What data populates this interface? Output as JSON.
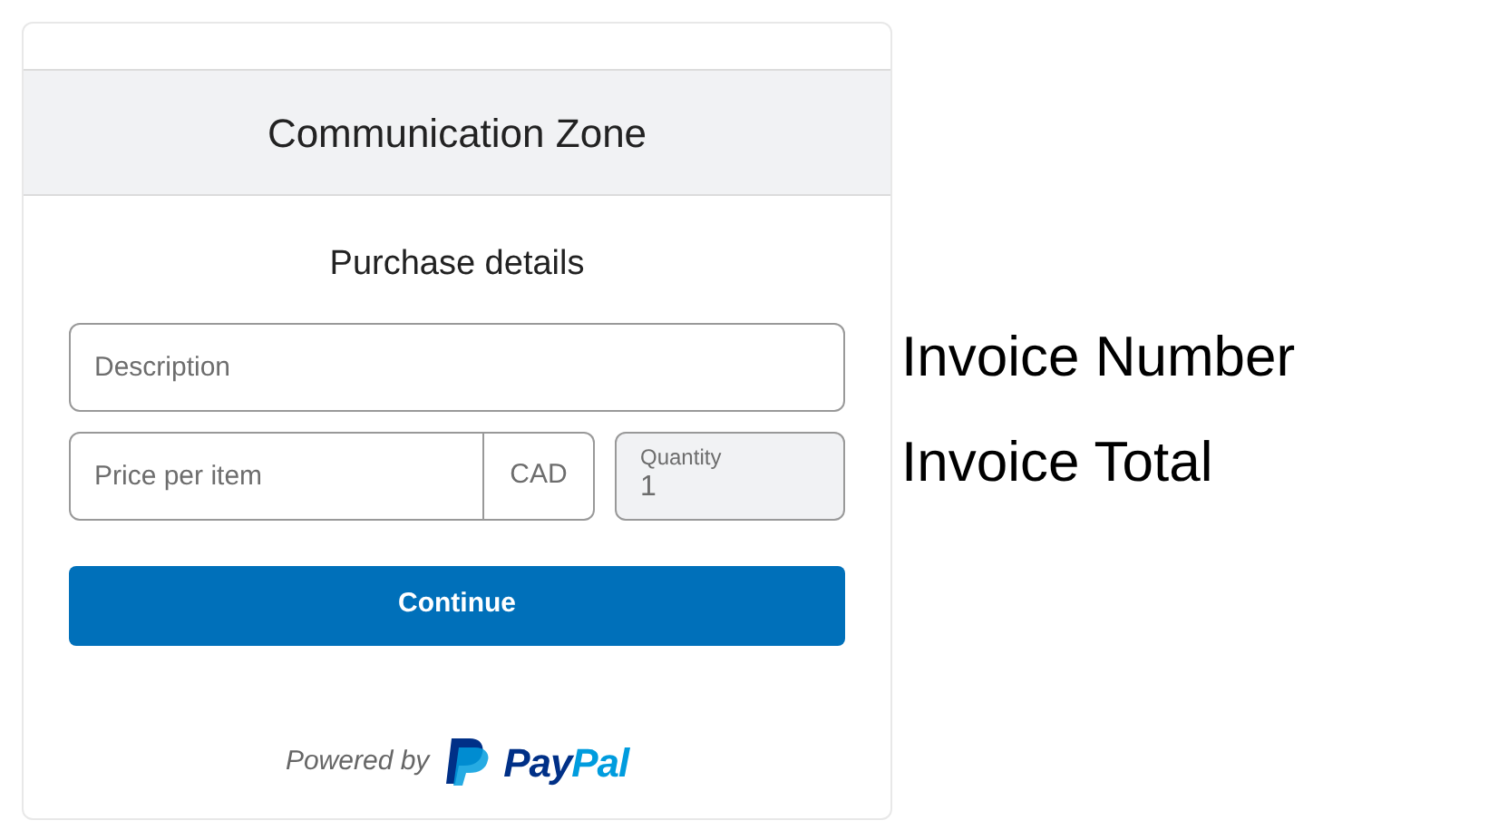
{
  "card": {
    "title": "Communication Zone",
    "subtitle": "Purchase details",
    "description": {
      "placeholder": "Description"
    },
    "price": {
      "placeholder": "Price per item",
      "currency": "CAD"
    },
    "quantity": {
      "label": "Quantity",
      "value": "1",
      "disabled": true
    },
    "button": "Continue",
    "powered_by": "Powered by",
    "logo_text": [
      {
        "text": "Pay",
        "color": "#003087"
      },
      {
        "text": "Pal",
        "color": "#009cde"
      }
    ]
  },
  "side_labels": [
    "Invoice Number",
    "Invoice Total"
  ]
}
